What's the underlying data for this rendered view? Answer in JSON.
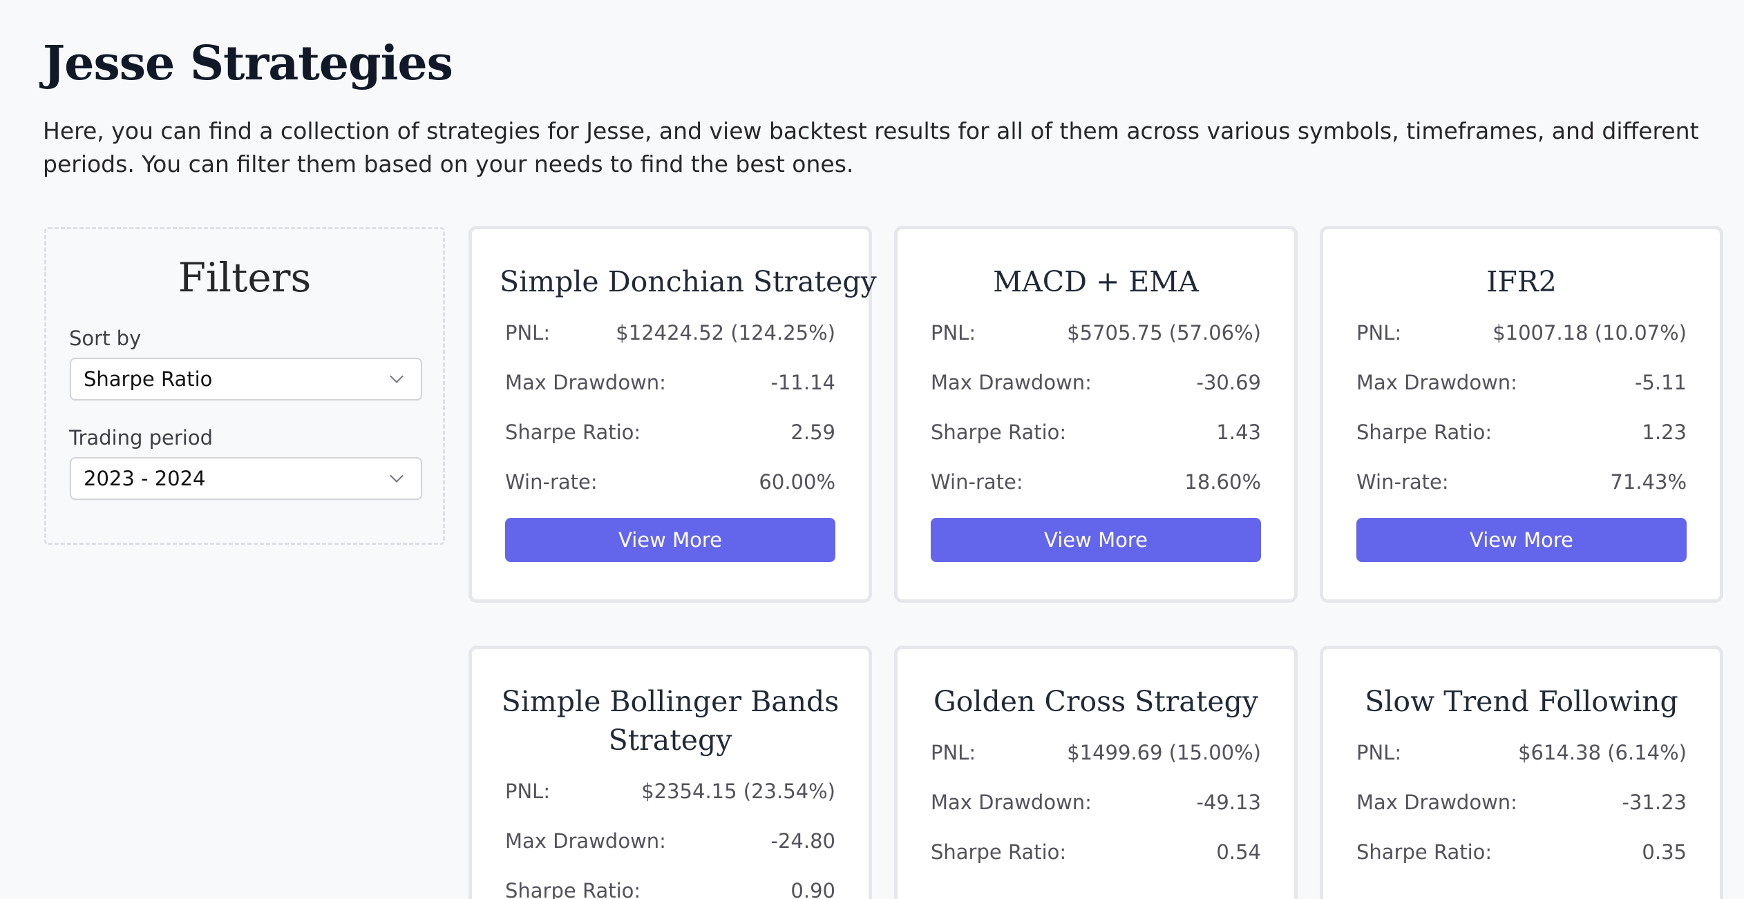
{
  "page": {
    "title": "Jesse Strategies",
    "intro": "Here, you can find a collection of strategies for Jesse, and view backtest results for all of them across various symbols, timeframes, and different periods. You can filter them based on your needs to find the best ones."
  },
  "filters": {
    "title": "Filters",
    "sort_by_label": "Sort by",
    "sort_by_value": "Sharpe Ratio",
    "period_label": "Trading period",
    "period_value": "2023 - 2024"
  },
  "labels": {
    "pnl": "PNL:",
    "max_drawdown": "Max Drawdown:",
    "sharpe": "Sharpe Ratio:",
    "winrate": "Win-rate:",
    "view_more": "View More"
  },
  "strategies": [
    {
      "name": "Simple Donchian Strategy",
      "pnl": "$12424.52 (124.25%)",
      "max_drawdown": "-11.14",
      "sharpe": "2.59",
      "winrate": "60.00%"
    },
    {
      "name": "MACD + EMA",
      "pnl": "$5705.75 (57.06%)",
      "max_drawdown": "-30.69",
      "sharpe": "1.43",
      "winrate": "18.60%"
    },
    {
      "name": "IFR2",
      "pnl": "$1007.18 (10.07%)",
      "max_drawdown": "-5.11",
      "sharpe": "1.23",
      "winrate": "71.43%"
    },
    {
      "name": "Simple Bollinger Bands Strategy",
      "pnl": "$2354.15 (23.54%)",
      "max_drawdown": "-24.80",
      "sharpe": "0.90"
    },
    {
      "name": "Golden Cross Strategy",
      "pnl": "$1499.69 (15.00%)",
      "max_drawdown": "-49.13",
      "sharpe": "0.54"
    },
    {
      "name": "Slow Trend Following",
      "pnl": "$614.38 (6.14%)",
      "max_drawdown": "-31.23",
      "sharpe": "0.35"
    }
  ],
  "colors": {
    "accent": "#6366ea",
    "background": "#f8f9fb",
    "card_border": "#e5e7eb"
  }
}
